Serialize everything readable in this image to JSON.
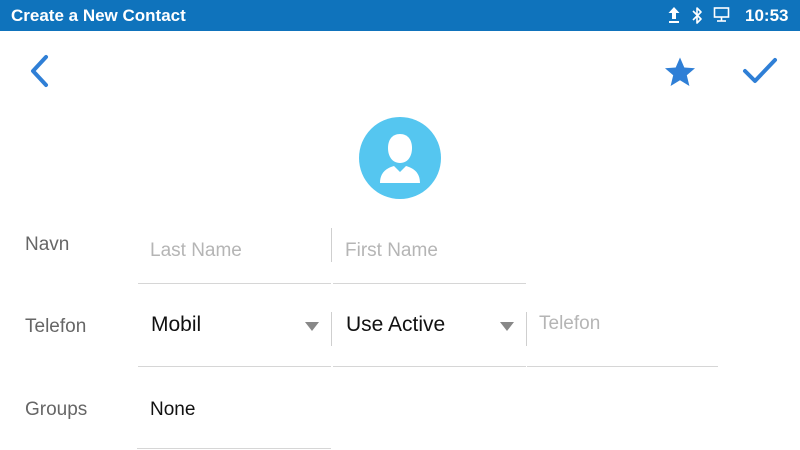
{
  "statusbar": {
    "title": "Create a New Contact",
    "time": "10:53",
    "icons": [
      "upload-icon",
      "bluetooth-icon",
      "monitor-icon"
    ],
    "color": "#0f73bc"
  },
  "toolbar": {
    "back_icon": "chevron-left-icon",
    "favorite_icon": "star-icon",
    "save_icon": "checkmark-icon",
    "accent": "#2f7fd6"
  },
  "avatar": {
    "icon": "person-icon",
    "color": "#55c6f0"
  },
  "form": {
    "name": {
      "label": "Navn",
      "last_name_placeholder": "Last Name",
      "first_name_placeholder": "First Name"
    },
    "phone": {
      "label": "Telefon",
      "type_value": "Mobil",
      "account_value": "Use Active",
      "number_placeholder": "Telefon"
    },
    "groups": {
      "label": "Groups",
      "value": "None"
    }
  }
}
